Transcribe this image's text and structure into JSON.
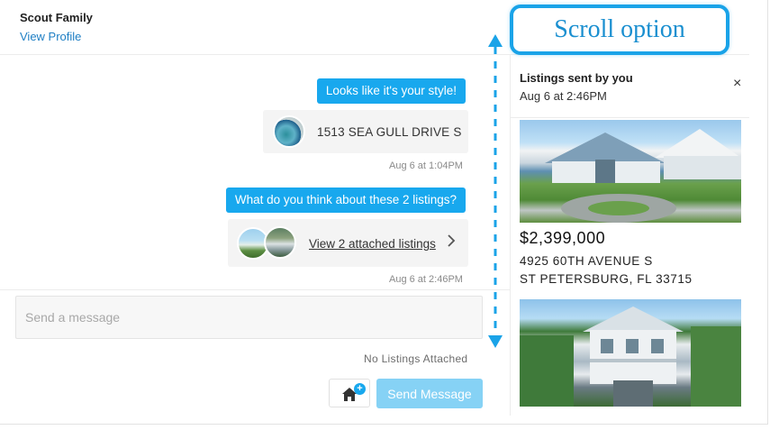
{
  "header": {
    "contact_name": "Scout Family",
    "view_profile": "View Profile"
  },
  "annotation": {
    "callout_text": "Scroll option",
    "color": "#1aa3e8"
  },
  "messages": [
    {
      "text": "Looks like it's your style!",
      "attachment_address": "1513 SEA GULL DRIVE S",
      "timestamp": "Aug 6 at 1:04PM"
    },
    {
      "text": "What do you think about these 2 listings?",
      "attachment_link": "View 2 attached listings",
      "timestamp": "Aug 6 at 2:46PM"
    }
  ],
  "composer": {
    "placeholder": "Send a message",
    "attachments_status": "No Listings Attached",
    "send_label": "Send Message",
    "attach_icon": "home-plus-icon"
  },
  "panel": {
    "title": "Listings sent by you",
    "date": "Aug 6 at 2:46PM",
    "close_symbol": "×",
    "listings": [
      {
        "price": "$2,399,000",
        "address_line1": "4925 60TH AVENUE S",
        "address_line2": "ST PETERSBURG, FL 33715"
      }
    ]
  },
  "colors": {
    "accent": "#18a8ee",
    "send_disabled": "#86d2f5",
    "link": "#1f7fc4"
  }
}
